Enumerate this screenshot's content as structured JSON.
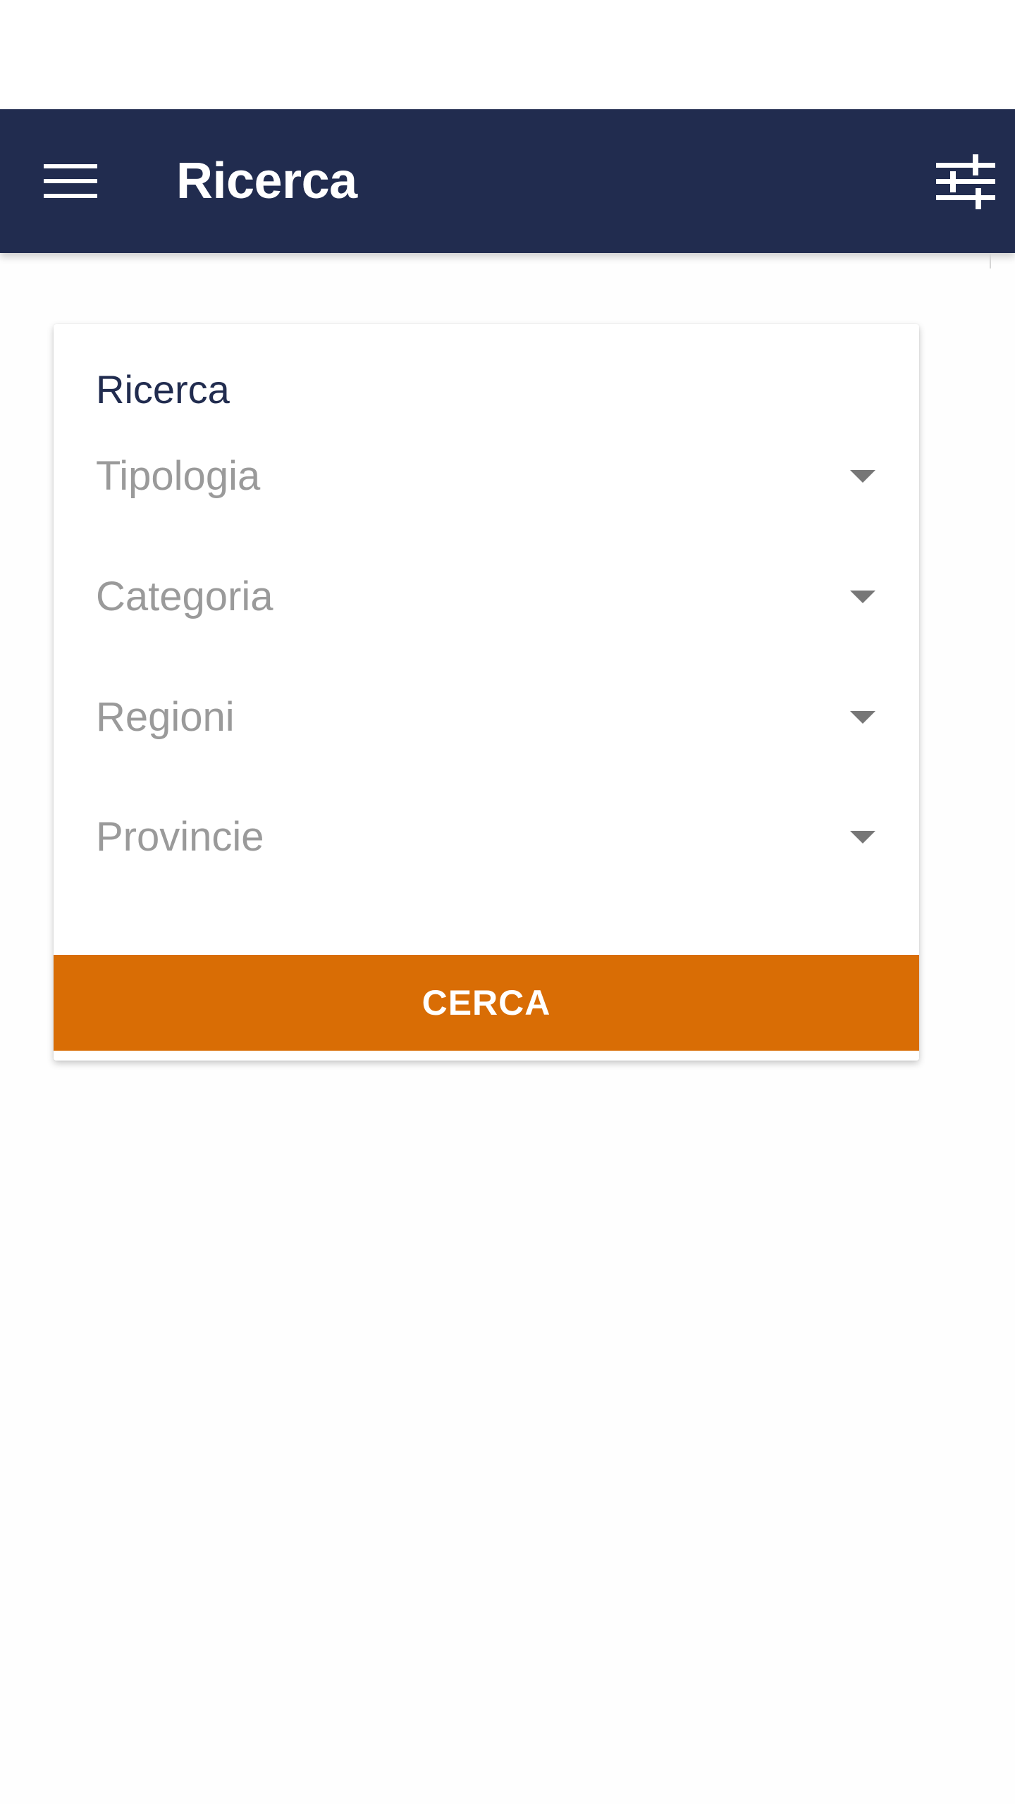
{
  "colors": {
    "navy": "#212c4f",
    "orange": "#d96d05"
  },
  "app_bar": {
    "title": "Ricerca",
    "menu_icon": "hamburger-menu-icon",
    "filter_icon": "tune-sliders-icon"
  },
  "search_card": {
    "title": "Ricerca",
    "selects": [
      {
        "label": "Tipologia"
      },
      {
        "label": "Categoria"
      },
      {
        "label": "Regioni"
      },
      {
        "label": "Provincie"
      }
    ],
    "button_label": "CERCA"
  }
}
